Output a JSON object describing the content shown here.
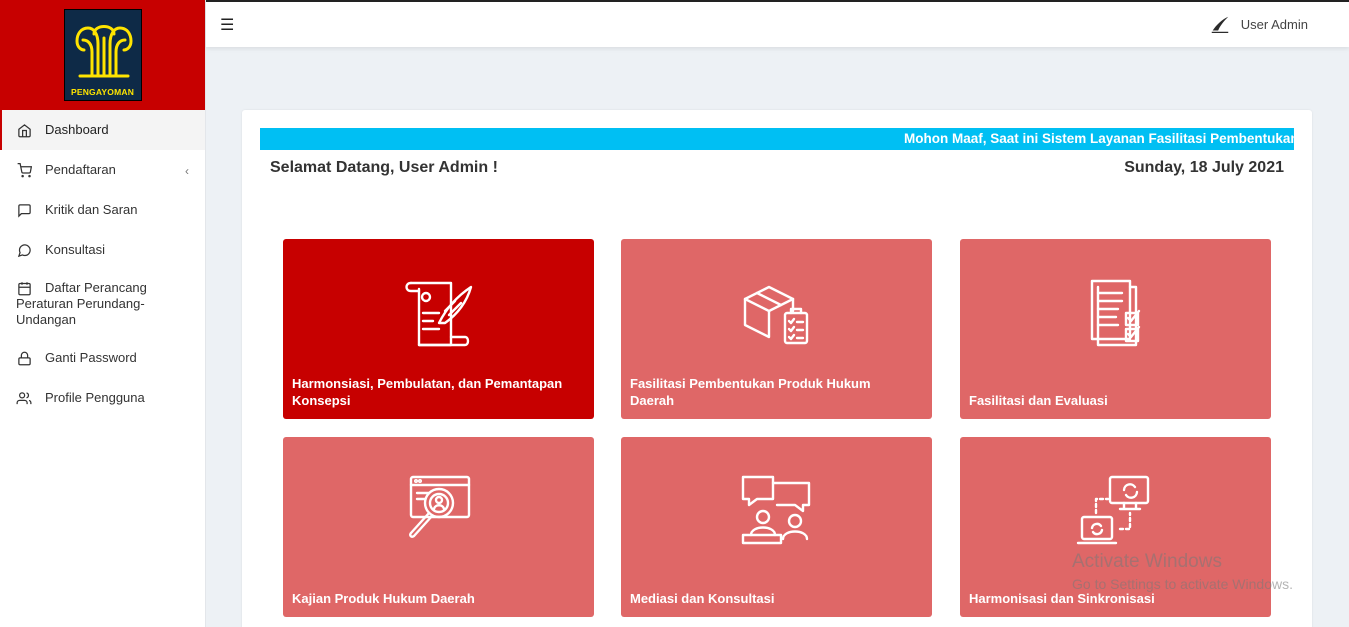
{
  "brand": {
    "logo_text": "PENGAYOMAN",
    "logo_bg": "#0e2a47",
    "logo_fg": "#ffe400",
    "header_bg": "#c70000"
  },
  "sidebar": {
    "items": [
      {
        "label": "Dashboard",
        "icon": "home-icon",
        "active": true
      },
      {
        "label": "Pendaftaran",
        "icon": "cart-icon",
        "has_submenu": true
      },
      {
        "label": "Kritik dan Saran",
        "icon": "message-square-icon"
      },
      {
        "label": "Konsultasi",
        "icon": "message-circle-icon"
      },
      {
        "label": "Daftar Perancang Peraturan Perundang-Undangan",
        "icon": "calendar-icon"
      },
      {
        "label": "Ganti Password",
        "icon": "lock-icon"
      },
      {
        "label": "Profile Pengguna",
        "icon": "users-icon"
      }
    ]
  },
  "topbar": {
    "menu_icon": "hamburger-icon",
    "user_name": "User Admin"
  },
  "main": {
    "marquee_text": "Mohon Maaf, Saat ini Sistem Layanan Fasilitasi Pembentukan Produk Hukum Daerah",
    "welcome": "Selamat Datang, User Admin !",
    "date": "Sunday, 18 July 2021",
    "tiles": [
      {
        "label": "Harmonsiasi, Pembulatan, dan Pemantapan Konsepsi",
        "icon": "scroll-quill-icon",
        "active": true
      },
      {
        "label": "Fasilitasi Pembentukan Produk Hukum Daerah",
        "icon": "box-checklist-icon"
      },
      {
        "label": "Fasilitasi dan Evaluasi",
        "icon": "documents-check-icon"
      },
      {
        "label": "Kajian Produk Hukum Daerah",
        "icon": "magnifier-browser-icon"
      },
      {
        "label": "Mediasi dan Konsultasi",
        "icon": "chat-people-icon"
      },
      {
        "label": "Harmonisasi dan Sinkronisasi",
        "icon": "sync-devices-icon"
      }
    ]
  },
  "colors": {
    "accent": "#c70000",
    "tile": "#df6767",
    "marquee": "#00bff3"
  },
  "watermark": {
    "title": "Activate Windows",
    "subtitle": "Go to Settings to activate Windows."
  }
}
